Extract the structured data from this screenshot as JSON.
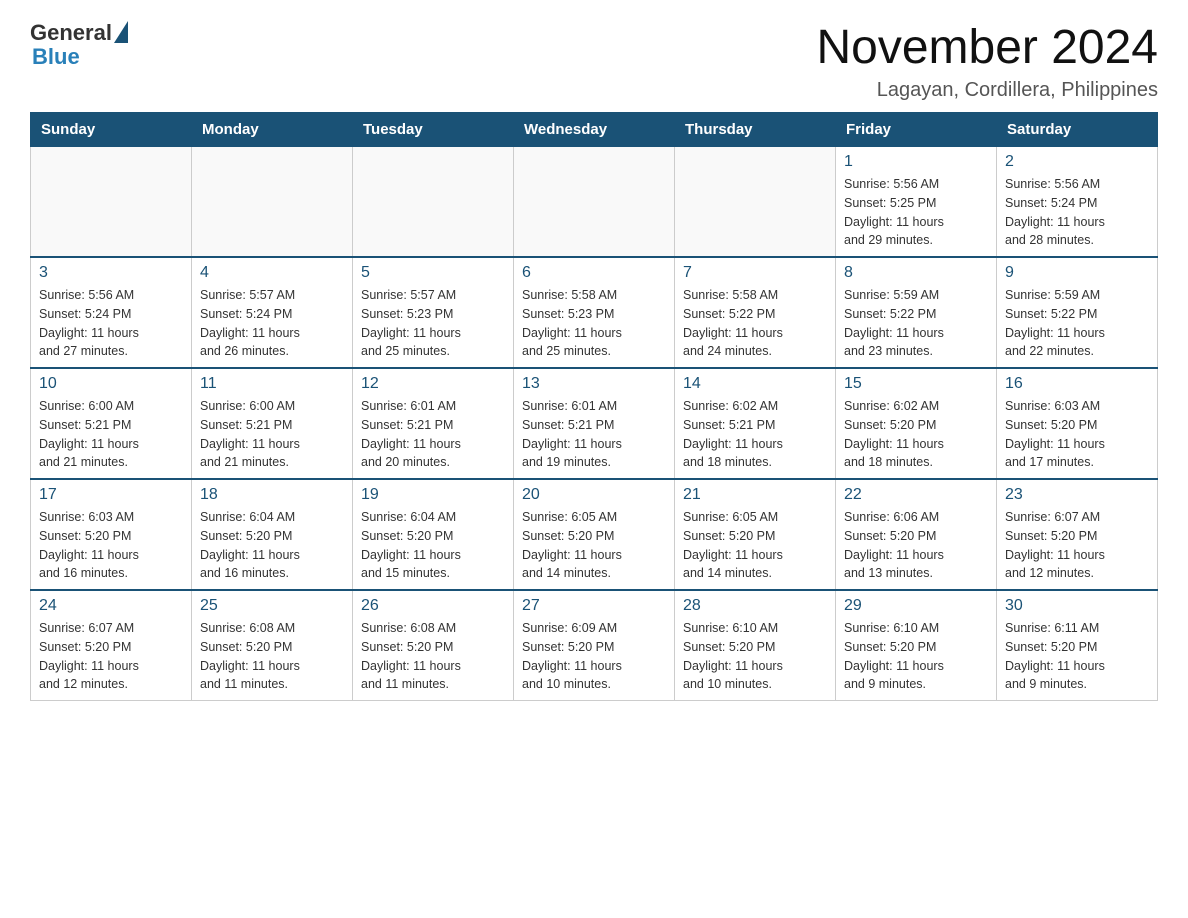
{
  "header": {
    "logo_general": "General",
    "logo_blue": "Blue",
    "month_title": "November 2024",
    "location": "Lagayan, Cordillera, Philippines"
  },
  "weekdays": [
    "Sunday",
    "Monday",
    "Tuesday",
    "Wednesday",
    "Thursday",
    "Friday",
    "Saturday"
  ],
  "weeks": [
    [
      {
        "day": "",
        "info": ""
      },
      {
        "day": "",
        "info": ""
      },
      {
        "day": "",
        "info": ""
      },
      {
        "day": "",
        "info": ""
      },
      {
        "day": "",
        "info": ""
      },
      {
        "day": "1",
        "info": "Sunrise: 5:56 AM\nSunset: 5:25 PM\nDaylight: 11 hours\nand 29 minutes."
      },
      {
        "day": "2",
        "info": "Sunrise: 5:56 AM\nSunset: 5:24 PM\nDaylight: 11 hours\nand 28 minutes."
      }
    ],
    [
      {
        "day": "3",
        "info": "Sunrise: 5:56 AM\nSunset: 5:24 PM\nDaylight: 11 hours\nand 27 minutes."
      },
      {
        "day": "4",
        "info": "Sunrise: 5:57 AM\nSunset: 5:24 PM\nDaylight: 11 hours\nand 26 minutes."
      },
      {
        "day": "5",
        "info": "Sunrise: 5:57 AM\nSunset: 5:23 PM\nDaylight: 11 hours\nand 25 minutes."
      },
      {
        "day": "6",
        "info": "Sunrise: 5:58 AM\nSunset: 5:23 PM\nDaylight: 11 hours\nand 25 minutes."
      },
      {
        "day": "7",
        "info": "Sunrise: 5:58 AM\nSunset: 5:22 PM\nDaylight: 11 hours\nand 24 minutes."
      },
      {
        "day": "8",
        "info": "Sunrise: 5:59 AM\nSunset: 5:22 PM\nDaylight: 11 hours\nand 23 minutes."
      },
      {
        "day": "9",
        "info": "Sunrise: 5:59 AM\nSunset: 5:22 PM\nDaylight: 11 hours\nand 22 minutes."
      }
    ],
    [
      {
        "day": "10",
        "info": "Sunrise: 6:00 AM\nSunset: 5:21 PM\nDaylight: 11 hours\nand 21 minutes."
      },
      {
        "day": "11",
        "info": "Sunrise: 6:00 AM\nSunset: 5:21 PM\nDaylight: 11 hours\nand 21 minutes."
      },
      {
        "day": "12",
        "info": "Sunrise: 6:01 AM\nSunset: 5:21 PM\nDaylight: 11 hours\nand 20 minutes."
      },
      {
        "day": "13",
        "info": "Sunrise: 6:01 AM\nSunset: 5:21 PM\nDaylight: 11 hours\nand 19 minutes."
      },
      {
        "day": "14",
        "info": "Sunrise: 6:02 AM\nSunset: 5:21 PM\nDaylight: 11 hours\nand 18 minutes."
      },
      {
        "day": "15",
        "info": "Sunrise: 6:02 AM\nSunset: 5:20 PM\nDaylight: 11 hours\nand 18 minutes."
      },
      {
        "day": "16",
        "info": "Sunrise: 6:03 AM\nSunset: 5:20 PM\nDaylight: 11 hours\nand 17 minutes."
      }
    ],
    [
      {
        "day": "17",
        "info": "Sunrise: 6:03 AM\nSunset: 5:20 PM\nDaylight: 11 hours\nand 16 minutes."
      },
      {
        "day": "18",
        "info": "Sunrise: 6:04 AM\nSunset: 5:20 PM\nDaylight: 11 hours\nand 16 minutes."
      },
      {
        "day": "19",
        "info": "Sunrise: 6:04 AM\nSunset: 5:20 PM\nDaylight: 11 hours\nand 15 minutes."
      },
      {
        "day": "20",
        "info": "Sunrise: 6:05 AM\nSunset: 5:20 PM\nDaylight: 11 hours\nand 14 minutes."
      },
      {
        "day": "21",
        "info": "Sunrise: 6:05 AM\nSunset: 5:20 PM\nDaylight: 11 hours\nand 14 minutes."
      },
      {
        "day": "22",
        "info": "Sunrise: 6:06 AM\nSunset: 5:20 PM\nDaylight: 11 hours\nand 13 minutes."
      },
      {
        "day": "23",
        "info": "Sunrise: 6:07 AM\nSunset: 5:20 PM\nDaylight: 11 hours\nand 12 minutes."
      }
    ],
    [
      {
        "day": "24",
        "info": "Sunrise: 6:07 AM\nSunset: 5:20 PM\nDaylight: 11 hours\nand 12 minutes."
      },
      {
        "day": "25",
        "info": "Sunrise: 6:08 AM\nSunset: 5:20 PM\nDaylight: 11 hours\nand 11 minutes."
      },
      {
        "day": "26",
        "info": "Sunrise: 6:08 AM\nSunset: 5:20 PM\nDaylight: 11 hours\nand 11 minutes."
      },
      {
        "day": "27",
        "info": "Sunrise: 6:09 AM\nSunset: 5:20 PM\nDaylight: 11 hours\nand 10 minutes."
      },
      {
        "day": "28",
        "info": "Sunrise: 6:10 AM\nSunset: 5:20 PM\nDaylight: 11 hours\nand 10 minutes."
      },
      {
        "day": "29",
        "info": "Sunrise: 6:10 AM\nSunset: 5:20 PM\nDaylight: 11 hours\nand 9 minutes."
      },
      {
        "day": "30",
        "info": "Sunrise: 6:11 AM\nSunset: 5:20 PM\nDaylight: 11 hours\nand 9 minutes."
      }
    ]
  ]
}
